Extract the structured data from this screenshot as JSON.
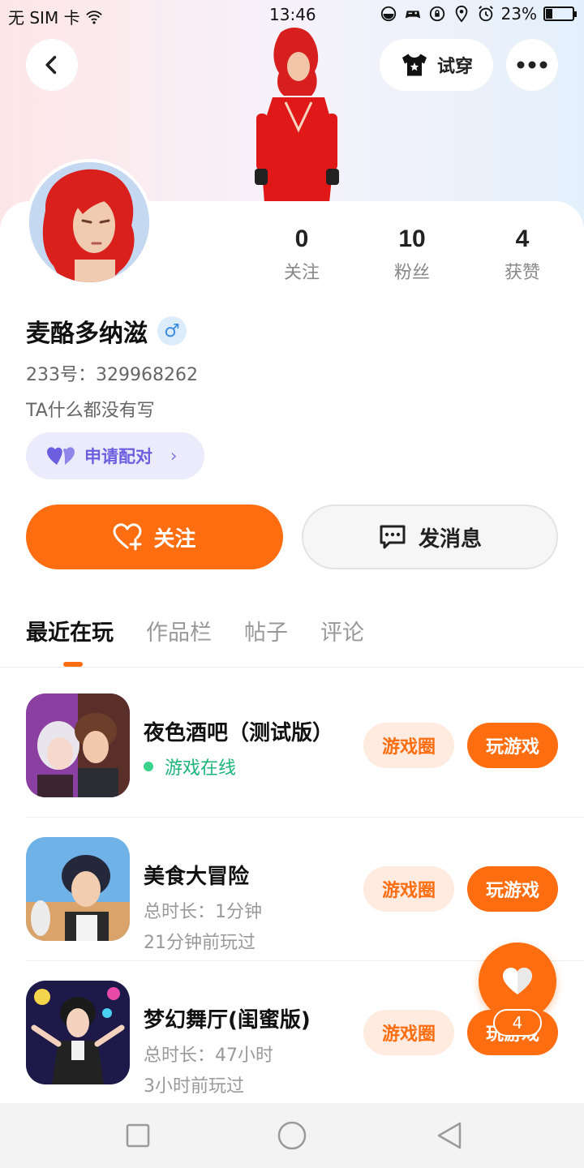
{
  "status_bar": {
    "carrier": "无 SIM 卡",
    "time": "13:46",
    "battery_percent": "23%",
    "battery_level": 0.23
  },
  "header": {
    "try_on_label": "试穿"
  },
  "profile": {
    "stats": [
      {
        "value": "0",
        "label": "关注"
      },
      {
        "value": "10",
        "label": "粉丝"
      },
      {
        "value": "4",
        "label": "获赞"
      }
    ],
    "username": "麦酪多纳滋",
    "gender_symbol": "♂",
    "uid": "233号：329968262",
    "bio": "TA什么都没有写",
    "pair_label": "申请配对",
    "pair_chevron": "›",
    "follow_label": "关注",
    "message_label": "发消息"
  },
  "tabs": [
    {
      "label": "最近在玩",
      "active": true
    },
    {
      "label": "作品栏",
      "active": false
    },
    {
      "label": "帖子",
      "active": false
    },
    {
      "label": "评论",
      "active": false
    }
  ],
  "games": [
    {
      "name": "夜色酒吧（测试版）",
      "status": "游戏在线",
      "circle_label": "游戏圈",
      "play_label": "玩游戏"
    },
    {
      "name": "美食大冒险",
      "duration": "总时长：1分钟",
      "last_played": "21分钟前玩过",
      "circle_label": "游戏圈",
      "play_label": "玩游戏"
    },
    {
      "name": "梦幻舞厅(闺蜜版)",
      "duration": "总时长：47小时",
      "last_played": "3小时前玩过",
      "circle_label": "游戏圈",
      "play_label": "玩游戏"
    }
  ],
  "fab": {
    "count": "4"
  },
  "colors": {
    "accent": "#fe6d10",
    "online": "#1db47a",
    "pair": "#6b5fe0"
  }
}
